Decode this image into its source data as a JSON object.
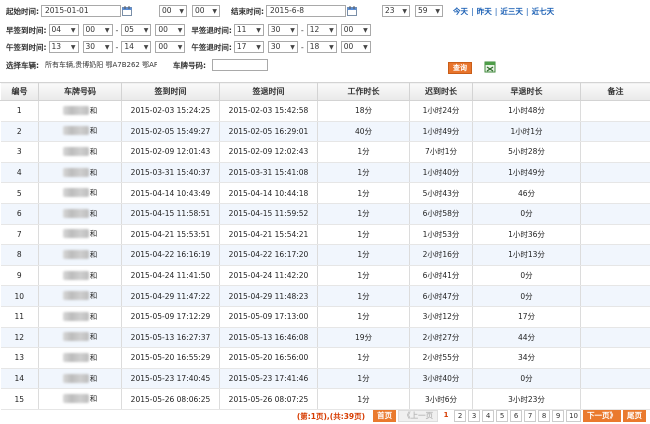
{
  "filters": {
    "start_label": "起始时间:",
    "start_date": "2015-01-01",
    "start_hour": "00",
    "start_min": "00",
    "end_label": "结束时间:",
    "end_date": "2015-6-8",
    "end_hour": "23",
    "end_min": "59",
    "quick_links": [
      "今天",
      "昨天",
      "近三天",
      "近七天"
    ],
    "early_in_label": "早签到时间:",
    "early_in": {
      "h1": "04",
      "m1": "00",
      "h2": "05",
      "m2": "00"
    },
    "early_out_label": "早签退时间:",
    "early_out": {
      "h1": "11",
      "m1": "30",
      "h2": "12",
      "m2": "00"
    },
    "noon_in_label": "午签到时间:",
    "noon_in": {
      "h1": "13",
      "m1": "30",
      "h2": "14",
      "m2": "00"
    },
    "noon_out_label": "午签退时间:",
    "noon_out": {
      "h1": "17",
      "m1": "30",
      "h2": "18",
      "m2": "00"
    },
    "vehicle_label": "选择车辆:",
    "vehicle_value": "所有车辆,贵博奶阳 鄂A7B262 鄂AF",
    "plate_label": "车牌号码:",
    "plate_value": "",
    "search_label": "查询",
    "separator": "-"
  },
  "table": {
    "columns": [
      "编号",
      "车牌号码",
      "签到时间",
      "签退时间",
      "工作时长",
      "迟到时长",
      "早退时长",
      "备注"
    ],
    "rows": [
      {
        "no": "1",
        "plate": "和",
        "in": "2015-02-03 15:24:25",
        "out": "2015-02-03 15:42:58",
        "work": "18分",
        "late": "1小时24分",
        "early": "1小时48分",
        "note": ""
      },
      {
        "no": "2",
        "plate": "和",
        "in": "2015-02-05 15:49:27",
        "out": "2015-02-05 16:29:01",
        "work": "40分",
        "late": "1小时49分",
        "early": "1小时1分",
        "note": ""
      },
      {
        "no": "3",
        "plate": "和",
        "in": "2015-02-09 12:01:43",
        "out": "2015-02-09 12:02:43",
        "work": "1分",
        "late": "7小时1分",
        "early": "5小时28分",
        "note": ""
      },
      {
        "no": "4",
        "plate": "和",
        "in": "2015-03-31 15:40:37",
        "out": "2015-03-31 15:41:08",
        "work": "1分",
        "late": "1小时40分",
        "early": "1小时49分",
        "note": ""
      },
      {
        "no": "5",
        "plate": "和",
        "in": "2015-04-14 10:43:49",
        "out": "2015-04-14 10:44:18",
        "work": "1分",
        "late": "5小时43分",
        "early": "46分",
        "note": ""
      },
      {
        "no": "6",
        "plate": "和",
        "in": "2015-04-15 11:58:51",
        "out": "2015-04-15 11:59:52",
        "work": "1分",
        "late": "6小时58分",
        "early": "0分",
        "note": ""
      },
      {
        "no": "7",
        "plate": "和",
        "in": "2015-04-21 15:53:51",
        "out": "2015-04-21 15:54:21",
        "work": "1分",
        "late": "1小时53分",
        "early": "1小时36分",
        "note": ""
      },
      {
        "no": "8",
        "plate": "和",
        "in": "2015-04-22 16:16:19",
        "out": "2015-04-22 16:17:20",
        "work": "1分",
        "late": "2小时16分",
        "early": "1小时13分",
        "note": ""
      },
      {
        "no": "9",
        "plate": "和",
        "in": "2015-04-24 11:41:50",
        "out": "2015-04-24 11:42:20",
        "work": "1分",
        "late": "6小时41分",
        "early": "0分",
        "note": ""
      },
      {
        "no": "10",
        "plate": "和",
        "in": "2015-04-29 11:47:22",
        "out": "2015-04-29 11:48:23",
        "work": "1分",
        "late": "6小时47分",
        "early": "0分",
        "note": ""
      },
      {
        "no": "11",
        "plate": "和",
        "in": "2015-05-09 17:12:29",
        "out": "2015-05-09 17:13:00",
        "work": "1分",
        "late": "3小时12分",
        "early": "17分",
        "note": ""
      },
      {
        "no": "12",
        "plate": "和",
        "in": "2015-05-13 16:27:37",
        "out": "2015-05-13 16:46:08",
        "work": "19分",
        "late": "2小时27分",
        "early": "44分",
        "note": ""
      },
      {
        "no": "13",
        "plate": "和",
        "in": "2015-05-20 16:55:29",
        "out": "2015-05-20 16:56:00",
        "work": "1分",
        "late": "2小时55分",
        "early": "34分",
        "note": ""
      },
      {
        "no": "14",
        "plate": "和",
        "in": "2015-05-23 17:40:45",
        "out": "2015-05-23 17:41:46",
        "work": "1分",
        "late": "3小时40分",
        "early": "0分",
        "note": ""
      },
      {
        "no": "15",
        "plate": "和",
        "in": "2015-05-26 08:06:25",
        "out": "2015-05-26 08:07:25",
        "work": "1分",
        "late": "3小时6分",
        "early": "3小时23分",
        "note": ""
      }
    ]
  },
  "pager": {
    "info": "(第:1页),(共:39页)",
    "first": "首页",
    "prev": "《上一页",
    "pages": [
      "1",
      "2",
      "3",
      "4",
      "5",
      "6",
      "7",
      "8",
      "9",
      "10"
    ],
    "current": "1",
    "next": "下一页》",
    "last": "尾页"
  },
  "colors": {
    "accent": "#e8742b",
    "link": "#1a5fb4",
    "row_alt": "#f1f6fd"
  },
  "icons": {
    "calendar": "calendar-icon",
    "export": "excel-export-icon"
  }
}
